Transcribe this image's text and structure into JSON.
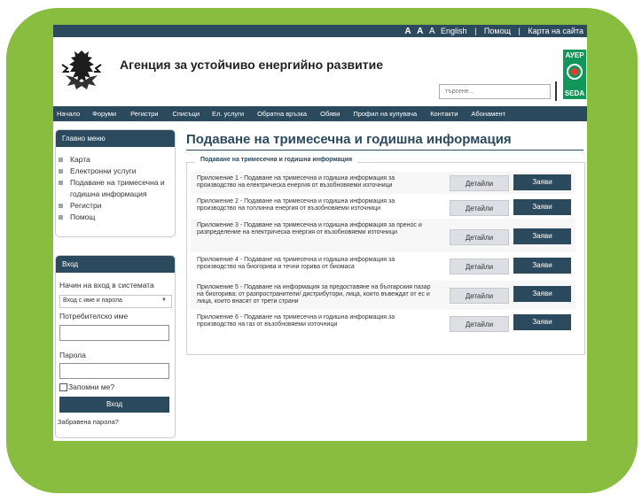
{
  "colors": {
    "accent": "#2c4a5e",
    "frame_green": "#88bd3f",
    "logo_green": "#12965a"
  },
  "top_bar": {
    "font_small": "A",
    "font_normal": "A",
    "font_large": "A",
    "english": "English",
    "help": "Помощ",
    "site_map": "Карта на сайта",
    "separator": "|"
  },
  "header": {
    "crest_icon": "lion-crest-icon",
    "title": "Агенция за устойчиво енергийно развитие",
    "search_placeholder": "търсене...",
    "logo_top": "АУЕР",
    "logo_bottom": "SEDA"
  },
  "nav": {
    "items": [
      "Начало",
      "Форуми",
      "Регистри",
      "Списъци",
      "Ел. услуги",
      "Обратна връзка",
      "Обяви",
      "Профил на купувача",
      "Контакти",
      "Абонамент"
    ]
  },
  "main_menu": {
    "title": "Главно меню",
    "items": [
      "Карта",
      "Електронни услуги",
      "Подаване на тримесечна и",
      "годишна информация",
      "Регистри",
      "Помощ"
    ]
  },
  "login": {
    "title": "Вход",
    "method_label": "Начин на вход в системата",
    "method_value": "Вход с име и парола",
    "username_label": "Потребителско име",
    "username_value": "",
    "password_label": "Парола",
    "password_value": "",
    "remember_label": "Запомни ме?",
    "button": "Вход",
    "forgot": "Забравена парола?"
  },
  "content": {
    "title": "Подаване на тримесечна и годишна информация",
    "section_legend": "Подаване на тримесечна и годишна информация",
    "details_label": "Детайли",
    "submit_label": "Заяви",
    "rows": [
      {
        "text": "Приложение 1 - Подаване на тримесечна и годишна информация за производство на електрическа енергия от възобновяеми източници"
      },
      {
        "text": "Приложение 2 - Подаване на тримесечна и годишна информация за производство на топлинна енергия от възобновяеми източници"
      },
      {
        "text": "Приложение 3 - Подаване на тримесечна и годишна информация за пренос и разпределение на електрическа енергия от възобновяеми източници"
      },
      {
        "text": "Приложение 4 - Подаване на тримесечна и годишна информация за производство на биогорива и течни горива от биомаса"
      },
      {
        "text": "Приложение 5 - Подаване на информация за предоставяне на българския пазар на биогорива: от разпространители/ дистрибутори, лица, които въвеждат от ес и лица, които внасят от трети страни"
      },
      {
        "text": "Приложение 6 - Подаване на тримесечна и годишна информация за производство на газ от възобновяеми източници"
      }
    ]
  }
}
